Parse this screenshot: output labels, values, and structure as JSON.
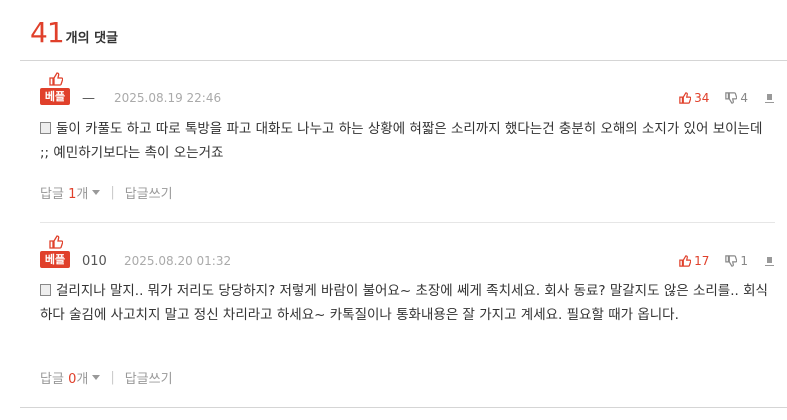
{
  "header": {
    "count": "41",
    "label": "개의 댓글"
  },
  "comments": [
    {
      "badge": "베플",
      "author": "—",
      "date": "2025.08.19 22:46",
      "up": "34",
      "down": "4",
      "text": "둘이 카풀도 하고 따로 톡방을 파고 대화도 나누고 하는 상황에 혀짧은 소리까지 했다는건 충분히 오해의 소지가 있어 보이는데 ;; 예민하기보다는 촉이 오는거죠",
      "reply_label": "답글",
      "reply_count": "1",
      "reply_suffix": "개",
      "write_reply": "답글쓰기"
    },
    {
      "badge": "베플",
      "author": "010",
      "date": "2025.08.20 01:32",
      "up": "17",
      "down": "1",
      "text": "걸리지나 말지.. 뭐가 저리도 당당하지? 저렇게 바람이 불어요~ 초장에 쎄게 족치세요. 회사 동료? 말갈지도 않은 소리를.. 회식하다 술김에 사고치지 말고 정신 차리라고 하세요~ 카톡질이나 통화내용은 잘 가지고 계세요. 필요할 때가 옵니다.",
      "reply_label": "답글",
      "reply_count": "0",
      "reply_suffix": "개",
      "write_reply": "답글쓰기"
    }
  ]
}
